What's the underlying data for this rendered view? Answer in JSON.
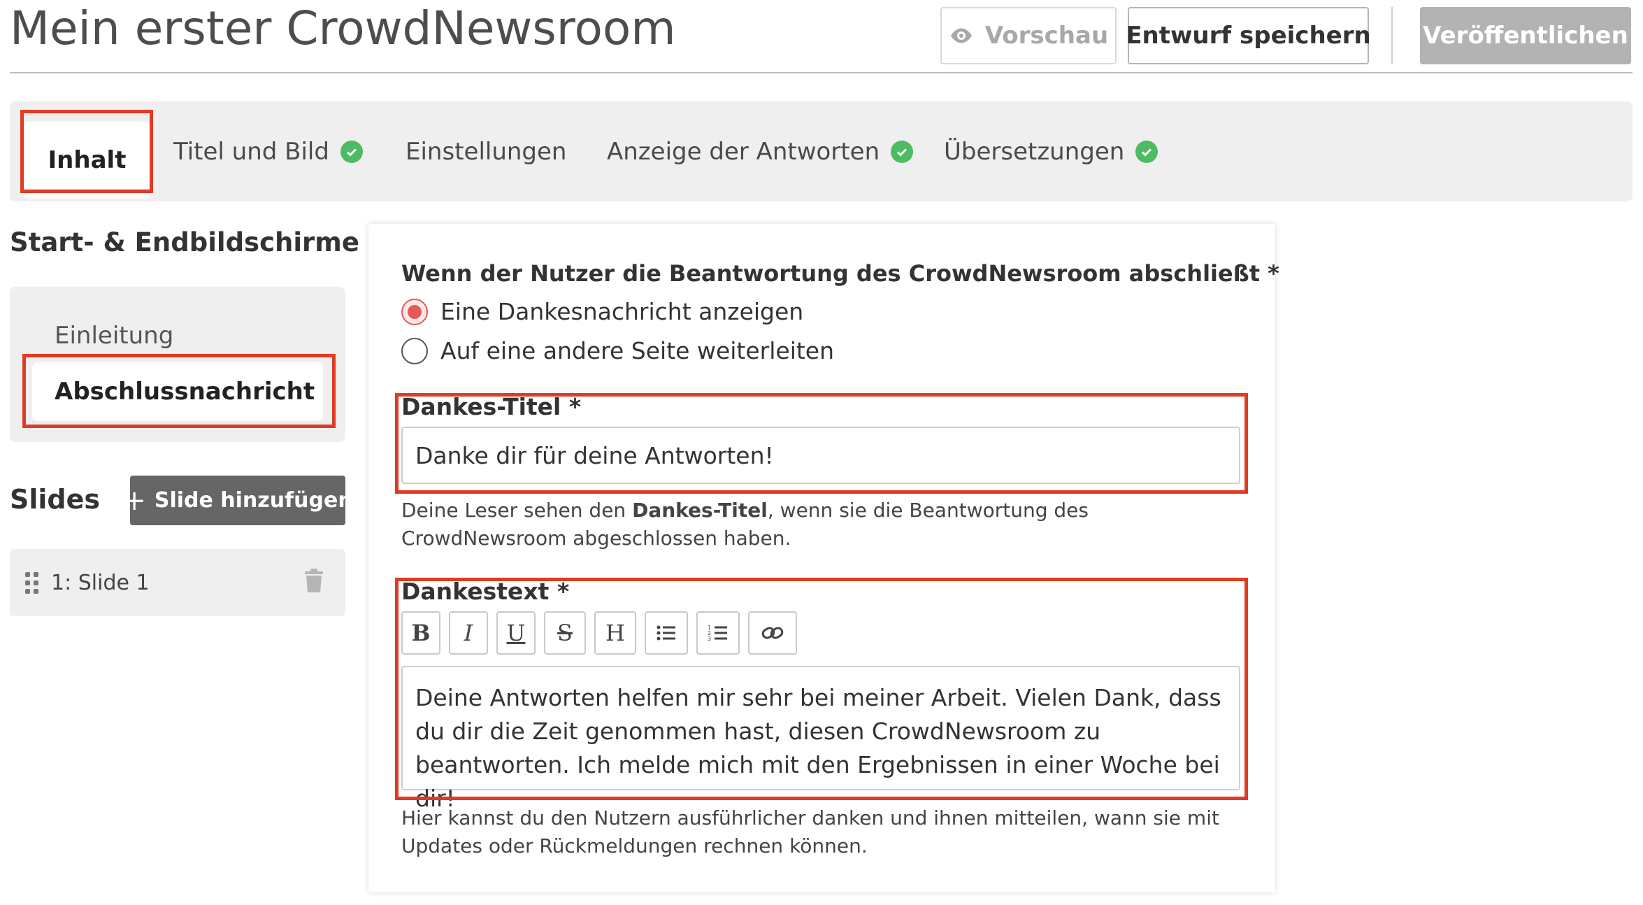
{
  "header": {
    "title": "Mein erster CrowdNewsroom",
    "preview_label": "Vorschau",
    "save_label": "Entwurf speichern",
    "publish_label": "Veröffentlichen"
  },
  "tabs": [
    {
      "label": "Inhalt",
      "active": true,
      "complete": false
    },
    {
      "label": "Titel und Bild",
      "active": false,
      "complete": true
    },
    {
      "label": "Einstellungen",
      "active": false,
      "complete": false
    },
    {
      "label": "Anzeige der Antworten",
      "active": false,
      "complete": true
    },
    {
      "label": "Übersetzungen",
      "active": false,
      "complete": true
    }
  ],
  "sidebar": {
    "heading": "Start- & Endbildschirme",
    "screens": [
      {
        "label": "Einleitung",
        "active": false
      },
      {
        "label": "Abschlussnachricht",
        "active": true
      }
    ],
    "slides_heading": "Slides",
    "add_slide_label": "Slide hinzufügen",
    "slides": [
      {
        "label": "1: Slide 1"
      }
    ]
  },
  "form": {
    "completion_question": "Wenn der Nutzer die Beantwortung des CrowdNewsroom abschließt *",
    "options": [
      {
        "label": "Eine Dankesnachricht anzeigen",
        "selected": true
      },
      {
        "label": "Auf eine andere Seite weiterleiten",
        "selected": false
      }
    ],
    "thanks_title_label": "Dankes-Titel *",
    "thanks_title_value": "Danke dir für deine Antworten!",
    "thanks_title_hint_pre": "Deine Leser sehen den ",
    "thanks_title_hint_bold": "Dankes-Titel",
    "thanks_title_hint_post": ", wenn sie die Beantwortung des CrowdNewsroom abgeschlossen haben.",
    "thanks_text_label": "Dankestext *",
    "toolbar": [
      "bold-icon",
      "italic-icon",
      "underline-icon",
      "strikethrough-icon",
      "heading-icon",
      "bullet-list-icon",
      "numbered-list-icon",
      "link-icon"
    ],
    "thanks_text_value": "Deine Antworten helfen mir sehr bei meiner Arbeit. Vielen Dank, dass du dir die Zeit genommen hast, diesen CrowdNewsroom zu beantworten. Ich melde mich mit den Ergebnissen in einer Woche bei dir!",
    "thanks_text_hint": "Hier kannst du den Nutzern ausführlicher danken und ihnen mitteilen, wann sie mit Updates oder Rückmeldungen rechnen können."
  },
  "colors": {
    "highlight": "#e03b24",
    "check": "#4cbb62",
    "radio_active": "#e35a5a"
  }
}
